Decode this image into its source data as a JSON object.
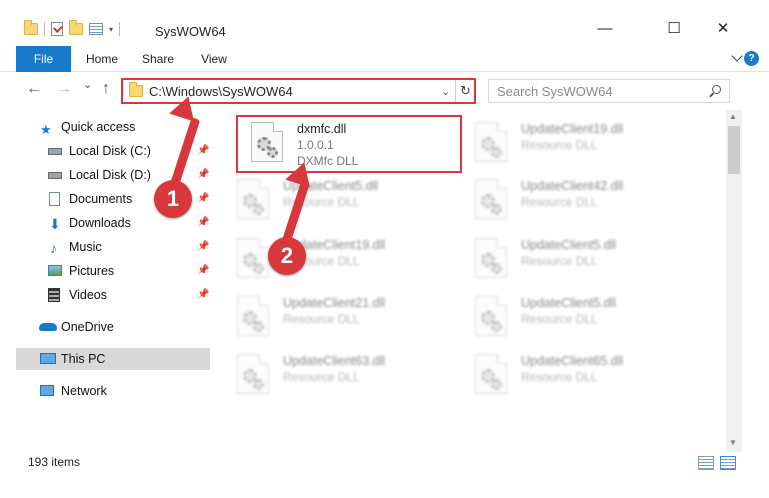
{
  "window": {
    "title": "SysWOW64",
    "minimize": "—",
    "maximize": "☐",
    "close": "✕"
  },
  "ribbon": {
    "tabs": [
      "File",
      "Home",
      "Share",
      "View"
    ],
    "help": "?"
  },
  "nav": {
    "back": "←",
    "forward": "→",
    "recent": "⌄",
    "up": "↑",
    "address": "C:\\Windows\\SysWOW64",
    "address_dropdown": "⌄",
    "refresh": "↻",
    "search_placeholder": "Search SysWOW64"
  },
  "sidebar": {
    "items": [
      {
        "label": "Quick access",
        "icon": "star-icon",
        "pinned": false
      },
      {
        "label": "Local Disk (C:)",
        "icon": "drive-icon",
        "pinned": true
      },
      {
        "label": "Local Disk (D:)",
        "icon": "drive-icon",
        "pinned": true
      },
      {
        "label": "Documents",
        "icon": "documents-icon",
        "pinned": true
      },
      {
        "label": "Downloads",
        "icon": "downloads-icon",
        "pinned": true
      },
      {
        "label": "Music",
        "icon": "music-icon",
        "pinned": true
      },
      {
        "label": "Pictures",
        "icon": "pictures-icon",
        "pinned": true
      },
      {
        "label": "Videos",
        "icon": "videos-icon",
        "pinned": true
      },
      {
        "label": "OneDrive",
        "icon": "onedrive-icon",
        "pinned": false
      },
      {
        "label": "This PC",
        "icon": "computer-icon",
        "pinned": false,
        "selected": true
      },
      {
        "label": "Network",
        "icon": "network-icon",
        "pinned": false
      }
    ],
    "pin_glyph": "📌"
  },
  "files": {
    "highlighted": {
      "name": "dxmfc.dll",
      "version": "1.0.0.1",
      "description": "DXMfc DLL"
    },
    "left_column": [
      {
        "name": "UpdateClient5.dll",
        "description": "Resource DLL"
      },
      {
        "name": "UpdateClient19.dll",
        "description": "Resource DLL"
      },
      {
        "name": "UpdateClient21.dll",
        "description": "Resource DLL"
      },
      {
        "name": "UpdateClient63.dll",
        "description": "Resource DLL"
      }
    ],
    "right_column": [
      {
        "name": "UpdateClient19.dll",
        "description": "Resource DLL"
      },
      {
        "name": "UpdateClient42.dll",
        "description": "Resource DLL"
      },
      {
        "name": "UpdateClient5.dll",
        "description": "Resource DLL"
      },
      {
        "name": "UpdateClient5.dll",
        "description": "Resource DLL"
      },
      {
        "name": "UpdateClient65.dll",
        "description": "Resource DLL"
      }
    ]
  },
  "status": {
    "item_count": "193 items"
  },
  "annotations": {
    "marker1": "1",
    "marker2": "2",
    "color": "#d8383b"
  },
  "colors": {
    "accent": "#1979ca",
    "selection": "#d9d9d9",
    "highlight": "#d8383b"
  }
}
